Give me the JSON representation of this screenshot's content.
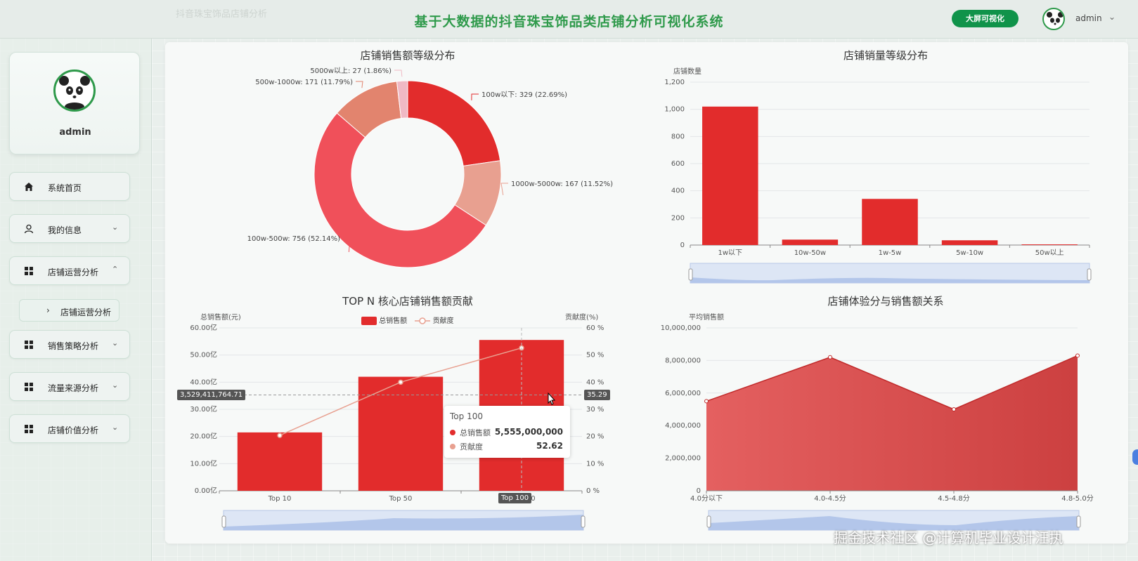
{
  "header": {
    "faint_text": "抖音珠宝饰品店铺分析",
    "title": "基于大数据的抖音珠宝饰品类店铺分析可视化系统",
    "big_screen_button": "大屏可视化",
    "username": "admin"
  },
  "sidebar": {
    "profile_name": "admin",
    "items": [
      {
        "label": "系统首页",
        "icon": "home-icon"
      },
      {
        "label": "我的信息",
        "icon": "user-icon"
      },
      {
        "label": "店铺运营分析",
        "icon": "grid-icon"
      },
      {
        "label": "销售策略分析",
        "icon": "grid-icon"
      },
      {
        "label": "流量来源分析",
        "icon": "grid-icon"
      },
      {
        "label": "店铺价值分析",
        "icon": "grid-icon"
      }
    ],
    "sub_item": "店铺运营分析"
  },
  "pie": {
    "title": "店铺销售额等级分布",
    "slices": [
      {
        "name": "100w以下",
        "label": "100w以下: 329 (22.69%)",
        "value": 329,
        "color": "#e22c2c"
      },
      {
        "name": "1000w-5000w",
        "label": "1000w-5000w: 167 (11.52%)",
        "value": 167,
        "color": "#e8a090"
      },
      {
        "name": "100w-500w",
        "label": "100w-500w: 756 (52.14%)",
        "value": 756,
        "color": "#f0505a"
      },
      {
        "name": "500w-1000w",
        "label": "500w-1000w: 171 (11.79%)",
        "value": 171,
        "color": "#e2846e"
      },
      {
        "name": "5000w以上",
        "label": "5000w以上: 27 (1.86%)",
        "value": 27,
        "color": "#f0b9c4"
      }
    ]
  },
  "bar_volume": {
    "title": "店铺销量等级分布",
    "ylabel": "店铺数量",
    "yticks": [
      "0",
      "200",
      "400",
      "600",
      "800",
      "1,000",
      "1,200"
    ],
    "categories": [
      "1w以下",
      "10w-50w",
      "1w-5w",
      "5w-10w",
      "50w以上"
    ]
  },
  "combo": {
    "title": "TOP N 核心店铺销售额贡献",
    "ylabel_left": "总销售额(元)",
    "ylabel_right": "贡献度(%)",
    "legend_bar": "总销售额",
    "legend_line": "贡献度",
    "yticks_left": [
      "0.00亿",
      "10.00亿",
      "20.00亿",
      "30.00亿",
      "40.00亿",
      "50.00亿",
      "60.00亿"
    ],
    "yticks_right": [
      "0 %",
      "10 %",
      "20 %",
      "30 %",
      "40 %",
      "50 %",
      "60 %"
    ],
    "categories": [
      "Top 10",
      "Top 50",
      "Top 100"
    ],
    "pointer_left": "3,529,411,764.71",
    "pointer_right": "35.29",
    "tooltip": {
      "title": "Top 100",
      "row1_name": "总销售额",
      "row1_value": "5,555,000,000",
      "row2_name": "贡献度",
      "row2_value": "52.62"
    }
  },
  "area": {
    "title": "店铺体验分与销售额关系",
    "ylabel": "平均销售额",
    "yticks": [
      "0",
      "2,000,000",
      "4,000,000",
      "6,000,000",
      "8,000,000",
      "10,000,000"
    ],
    "categories": [
      "4.0分以下",
      "4.0-4.5分",
      "4.5-4.8分",
      "4.8-5.0分"
    ]
  },
  "watermark": "掘金技术社区 @计算机毕业设计汪执",
  "chart_data": [
    {
      "type": "pie",
      "title": "店铺销售额等级分布",
      "categories": [
        "100w以下",
        "1000w-5000w",
        "100w-500w",
        "500w-1000w",
        "5000w以上"
      ],
      "values": [
        329,
        167,
        756,
        171,
        27
      ]
    },
    {
      "type": "bar",
      "title": "店铺销量等级分布",
      "ylabel": "店铺数量",
      "categories": [
        "1w以下",
        "10w-50w",
        "1w-5w",
        "5w-10w",
        "50w以上"
      ],
      "values": [
        1020,
        40,
        340,
        35,
        5
      ],
      "ylim": [
        0,
        1200
      ]
    },
    {
      "type": "bar",
      "title": "TOP N 核心店铺销售额贡献",
      "categories": [
        "Top 10",
        "Top 50",
        "Top 100"
      ],
      "series": [
        {
          "name": "总销售额",
          "values": [
            2150000000,
            4200000000,
            5555000000
          ],
          "axis": "left"
        },
        {
          "name": "贡献度",
          "values": [
            20.4,
            40,
            52.62
          ],
          "axis": "right",
          "type": "line"
        }
      ],
      "ylabel": "总销售额(元)",
      "ylim": [
        0,
        6000000000
      ],
      "ylim_right": [
        0,
        60
      ]
    },
    {
      "type": "area",
      "title": "店铺体验分与销售额关系",
      "ylabel": "平均销售额",
      "categories": [
        "4.0分以下",
        "4.0-4.5分",
        "4.5-4.8分",
        "4.8-5.0分"
      ],
      "values": [
        5500000,
        8200000,
        5000000,
        8300000
      ],
      "ylim": [
        0,
        10000000
      ]
    }
  ]
}
